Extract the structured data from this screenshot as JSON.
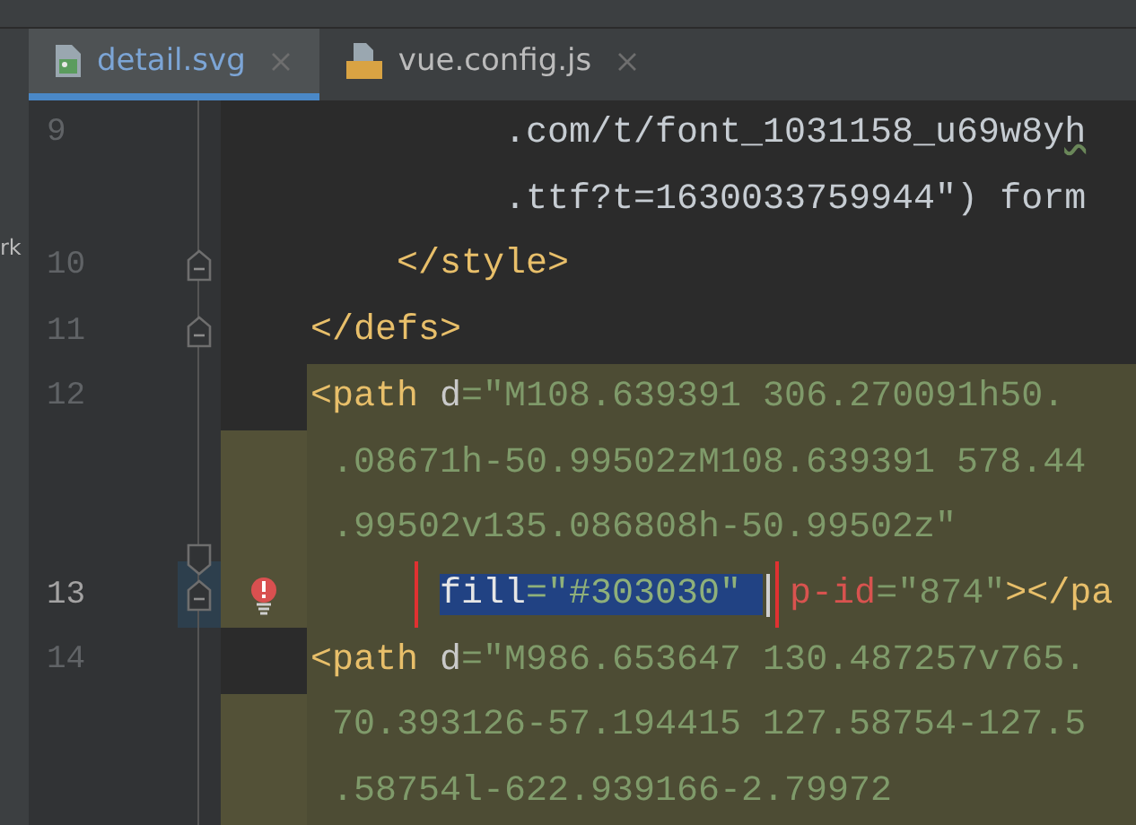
{
  "side_panel": {
    "label": "rk"
  },
  "tabs": [
    {
      "label": "detail.svg",
      "kind": "image",
      "selected": true
    },
    {
      "label": "vue.config.js",
      "kind": "script",
      "selected": false
    }
  ],
  "rows": [
    {
      "number": "9",
      "kind": "code",
      "fold_start": false,
      "fold_end": false,
      "bulb": false,
      "highlighted": false,
      "gutter_highlighted": false,
      "current": false,
      "segments": [
        {
          "kind": "plain",
          "text": "         .com/t/font_1031158_u69w8y",
          "warning": false
        },
        {
          "kind": "plain",
          "text": "h",
          "warning": true
        }
      ]
    },
    {
      "number": "",
      "kind": "code",
      "fold_start": false,
      "fold_end": false,
      "bulb": false,
      "highlighted": false,
      "gutter_highlighted": false,
      "current": false,
      "segments": [
        {
          "kind": "plain",
          "text": "         .ttf?t=1630033759944\") form"
        }
      ]
    },
    {
      "number": "10",
      "kind": "code",
      "fold_start": false,
      "fold_end": true,
      "bulb": false,
      "highlighted": false,
      "gutter_highlighted": false,
      "current": false,
      "segments": [
        {
          "kind": "tag",
          "text": "    </style>"
        }
      ]
    },
    {
      "number": "11",
      "kind": "code",
      "fold_start": false,
      "fold_end": true,
      "bulb": false,
      "highlighted": false,
      "gutter_highlighted": false,
      "current": false,
      "segments": [
        {
          "kind": "tag",
          "text": "</defs>"
        }
      ]
    },
    {
      "number": "12",
      "kind": "code",
      "fold_start": false,
      "fold_end": false,
      "bulb": false,
      "highlighted": true,
      "gutter_highlighted": false,
      "current": false,
      "segments": [
        {
          "kind": "tag",
          "text": "<path "
        },
        {
          "kind": "attr",
          "text": "d"
        },
        {
          "kind": "str",
          "text": "=\"M108.639391 306.270091h50."
        }
      ]
    },
    {
      "number": "",
      "kind": "code",
      "fold_start": false,
      "fold_end": false,
      "bulb": false,
      "highlighted": true,
      "gutter_highlighted": true,
      "current": false,
      "segments": [
        {
          "kind": "str",
          "text": " .08671h-50.99502zM108.639391 578.44"
        }
      ]
    },
    {
      "number": "",
      "kind": "code",
      "fold_start": true,
      "fold_end": false,
      "bulb": false,
      "highlighted": true,
      "gutter_highlighted": true,
      "current": false,
      "segments": [
        {
          "kind": "str",
          "text": " .99502v135.086808h-50.99502z\""
        }
      ]
    },
    {
      "number": "13",
      "kind": "attribute",
      "fold_start": false,
      "fold_end": true,
      "bulb": true,
      "highlighted": true,
      "gutter_highlighted": true,
      "current": true,
      "segments": [
        {
          "kind": "attr",
          "text": "fill",
          "selected": true,
          "boxed": true,
          "caret_after": false
        },
        {
          "kind": "str",
          "text": "=\"#303030\" ",
          "selected": true,
          "boxed": true,
          "caret_after": true
        },
        {
          "kind": "error",
          "text": "p-id",
          "selected": false,
          "boxed": false,
          "caret_after": false
        },
        {
          "kind": "str",
          "text": "=\"874\"",
          "selected": false,
          "boxed": false,
          "caret_after": false
        },
        {
          "kind": "tag",
          "text": "></pa",
          "selected": false,
          "boxed": false,
          "caret_after": false
        }
      ]
    },
    {
      "number": "14",
      "kind": "code",
      "fold_start": false,
      "fold_end": false,
      "bulb": false,
      "highlighted": true,
      "gutter_highlighted": false,
      "current": false,
      "segments": [
        {
          "kind": "tag",
          "text": "<path "
        },
        {
          "kind": "attr",
          "text": "d"
        },
        {
          "kind": "str",
          "text": "=\"M986.653647 130.487257v765."
        }
      ]
    },
    {
      "number": "",
      "kind": "code",
      "fold_start": false,
      "fold_end": false,
      "bulb": false,
      "highlighted": true,
      "gutter_highlighted": true,
      "current": false,
      "segments": [
        {
          "kind": "str",
          "text": " 70.393126-57.194415 127.58754-127.5"
        }
      ]
    },
    {
      "number": "",
      "kind": "code",
      "fold_start": false,
      "fold_end": false,
      "bulb": false,
      "highlighted": true,
      "gutter_highlighted": true,
      "current": false,
      "segments": [
        {
          "kind": "str",
          "text": " .58754l-622.939166-2.79972"
        }
      ]
    }
  ]
}
